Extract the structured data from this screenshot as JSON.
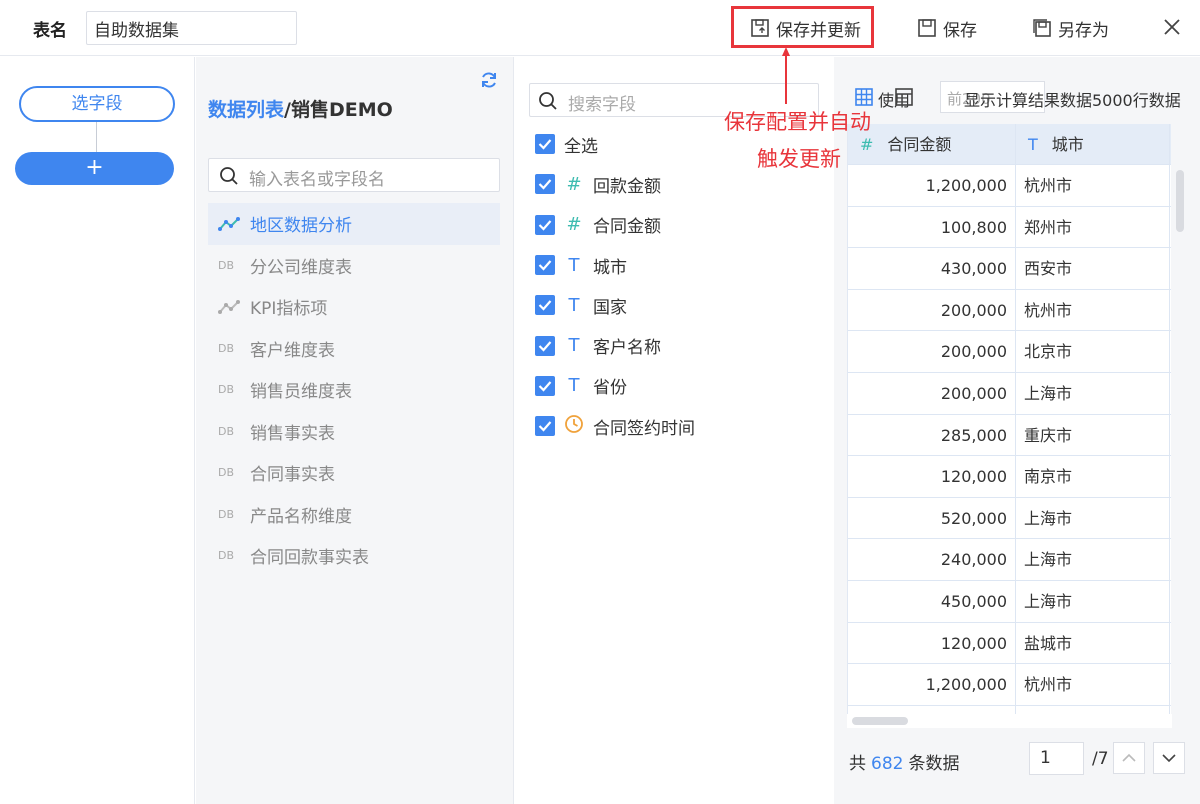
{
  "header": {
    "table_name_label": "表名",
    "table_name_value": "自助数据集",
    "save_update_label": "保存并更新",
    "save_label": "保存",
    "save_as_label": "另存为"
  },
  "left": {
    "pick_field_label": "选字段",
    "add_label": "+"
  },
  "tables": {
    "title_prefix": "数据列表",
    "title_suffix": "/销售DEMO",
    "search_placeholder": "输入表名或字段名",
    "items": [
      {
        "label": "地区数据分析",
        "icon": "chart-line-icon",
        "active": true
      },
      {
        "label": "分公司维度表",
        "icon": "db-icon"
      },
      {
        "label": "KPI指标项",
        "icon": "chart-line-icon"
      },
      {
        "label": "客户维度表",
        "icon": "db-icon"
      },
      {
        "label": "销售员维度表",
        "icon": "db-icon"
      },
      {
        "label": "销售事实表",
        "icon": "db-icon"
      },
      {
        "label": "合同事实表",
        "icon": "db-icon"
      },
      {
        "label": "产品名称维度",
        "icon": "db-icon"
      },
      {
        "label": "合同回款事实表",
        "icon": "db-icon"
      }
    ]
  },
  "fields": {
    "search_placeholder": "搜索字段",
    "select_all_label": "全选",
    "items": [
      {
        "label": "回款金额",
        "type": "#"
      },
      {
        "label": "合同金额",
        "type": "#"
      },
      {
        "label": "城市",
        "type": "T"
      },
      {
        "label": "国家",
        "type": "T"
      },
      {
        "label": "客户名称",
        "type": "T"
      },
      {
        "label": "省份",
        "type": "T"
      },
      {
        "label": "合同签约时间",
        "type": "clock"
      }
    ]
  },
  "annotation": {
    "line1": "保存配置并自动",
    "line2": "触发更新"
  },
  "preview": {
    "use_label": "使用",
    "rows_placeholder": "前200",
    "overlap_text": "显示计算结果数据5000行数据",
    "columns": [
      {
        "label": "合同金额",
        "type": "#"
      },
      {
        "label": "城市",
        "type": "T"
      }
    ],
    "rows": [
      [
        "1,200,000",
        "杭州市"
      ],
      [
        "100,800",
        "郑州市"
      ],
      [
        "430,000",
        "西安市"
      ],
      [
        "200,000",
        "杭州市"
      ],
      [
        "200,000",
        "北京市"
      ],
      [
        "200,000",
        "上海市"
      ],
      [
        "285,000",
        "重庆市"
      ],
      [
        "120,000",
        "南京市"
      ],
      [
        "520,000",
        "上海市"
      ],
      [
        "240,000",
        "上海市"
      ],
      [
        "450,000",
        "上海市"
      ],
      [
        "120,000",
        "盐城市"
      ],
      [
        "1,200,000",
        "杭州市"
      ],
      [
        "",
        ""
      ]
    ]
  },
  "pager": {
    "total_prefix": "共",
    "total_count": "682",
    "total_suffix": "条数据",
    "current_page": "1",
    "total_pages": "/7"
  },
  "colors": {
    "accent": "#3f86ef",
    "annotation": "#e8353b",
    "number_type": "#3ebcb0"
  }
}
